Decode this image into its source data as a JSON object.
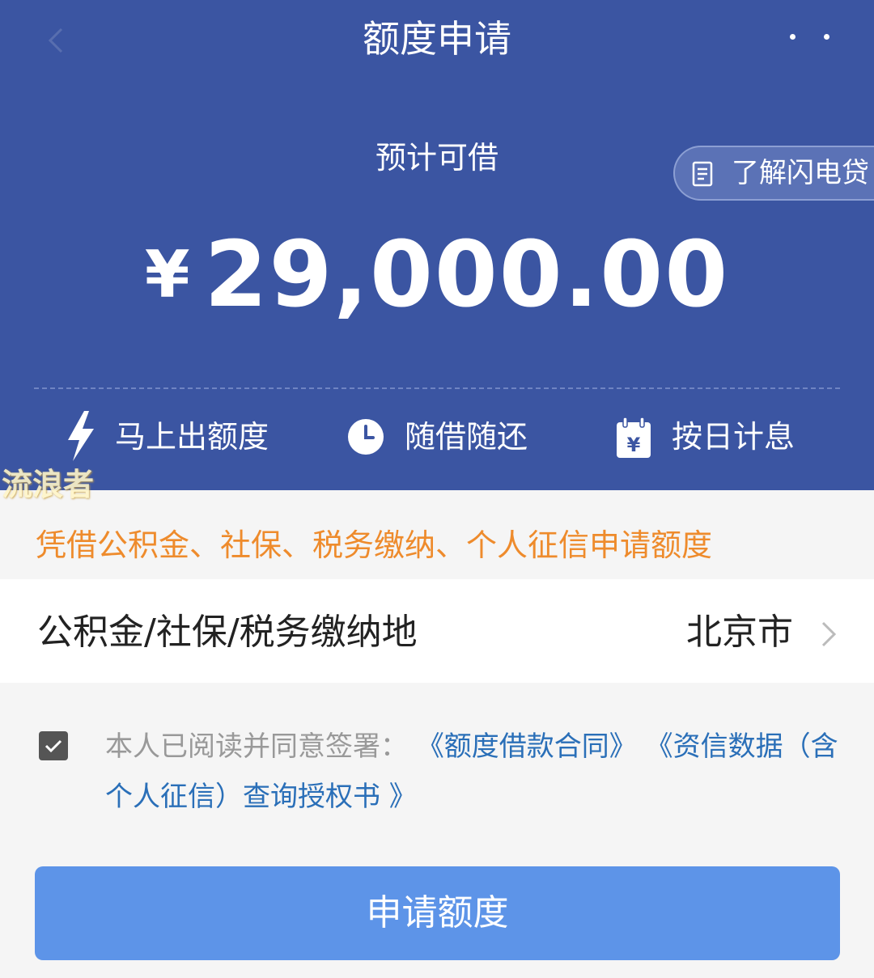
{
  "header": {
    "title": "额度申请",
    "back_icon": "back-arrow-icon",
    "more_icon": "more-dots-icon"
  },
  "summary": {
    "estimate_label": "预计可借",
    "currency_symbol": "¥",
    "amount": "29,000.00",
    "learn_button_label": "了解闪电贷",
    "learn_icon": "document-icon"
  },
  "features": [
    {
      "label": "马上出额度",
      "icon": "lightning-icon"
    },
    {
      "label": "随借随还",
      "icon": "clock-icon"
    },
    {
      "label": "按日计息",
      "icon": "calendar-yen-icon"
    }
  ],
  "watermark": "流浪者",
  "info_text": "凭借公积金、社保、税务缴纳、个人征信申请额度",
  "location": {
    "label": "公积金/社保/税务缴纳地",
    "value": "北京市"
  },
  "agreement": {
    "checked": true,
    "prefix": "本人已阅读并同意签署：",
    "link1": "《额度借款合同》",
    "link2": "《资信数据（含个人征信）查询授权书 》"
  },
  "apply_button_label": "申请额度",
  "colors": {
    "header_bg": "#3b55a2",
    "accent_orange": "#ee8b2c",
    "link_blue": "#2a6fb8",
    "button_blue": "#5d94e8"
  }
}
